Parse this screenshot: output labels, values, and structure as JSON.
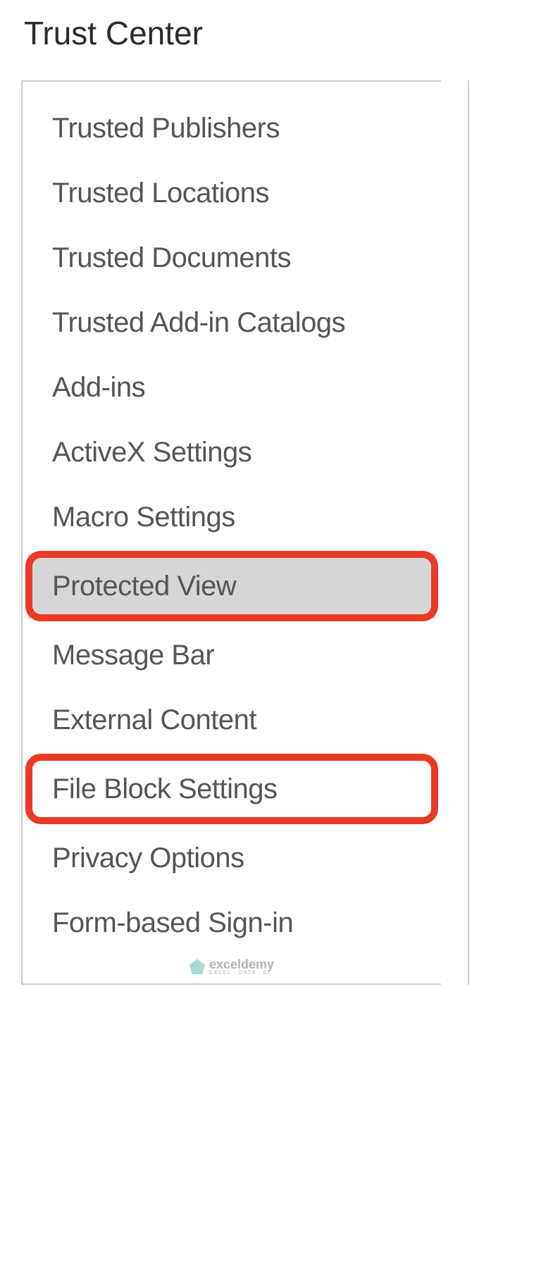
{
  "title": "Trust Center",
  "menu": {
    "items": [
      {
        "label": "Trusted Publishers",
        "selected": false,
        "highlighted": false
      },
      {
        "label": "Trusted Locations",
        "selected": false,
        "highlighted": false
      },
      {
        "label": "Trusted Documents",
        "selected": false,
        "highlighted": false
      },
      {
        "label": "Trusted Add-in Catalogs",
        "selected": false,
        "highlighted": false
      },
      {
        "label": "Add-ins",
        "selected": false,
        "highlighted": false
      },
      {
        "label": "ActiveX Settings",
        "selected": false,
        "highlighted": false
      },
      {
        "label": "Macro Settings",
        "selected": false,
        "highlighted": false
      },
      {
        "label": "Protected View",
        "selected": true,
        "highlighted": true
      },
      {
        "label": "Message Bar",
        "selected": false,
        "highlighted": false
      },
      {
        "label": "External Content",
        "selected": false,
        "highlighted": false
      },
      {
        "label": "File Block Settings",
        "selected": false,
        "highlighted": true
      },
      {
        "label": "Privacy Options",
        "selected": false,
        "highlighted": false
      },
      {
        "label": "Form-based Sign-in",
        "selected": false,
        "highlighted": false
      }
    ]
  },
  "watermark": {
    "name": "exceldemy",
    "tagline": "EXCEL · DATA · BI"
  }
}
